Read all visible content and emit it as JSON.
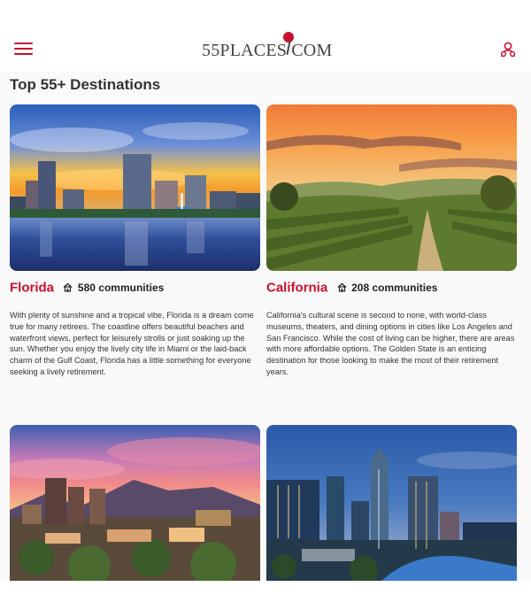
{
  "header": {
    "logo_text": "55PLACES COM"
  },
  "main": {
    "section_title": "Top 55+ Destinations"
  },
  "destinations": [
    {
      "name": "Florida",
      "count": "580 communities",
      "description": "With plenty of sunshine and a tropical vibe, Florida is a dream come true for many retirees. The coastline offers beautiful beaches and waterfront views, perfect for leisurely strolls or just soaking up the sun. Whether you enjoy the lively city life in Miami or the laid-back charm of the Gulf Coast, Florida has a little something for everyone seeking a lively retirement."
    },
    {
      "name": "California",
      "count": "208 communities",
      "description": "California's cultural scene is second to none, with world-class museums, theaters, and dining options in cities like Los Angeles and San Francisco. While the cost of living can be higher, there are areas with more affordable options. The Golden State is an enticing destination for those looking to make the most of their retirement years."
    },
    {
      "name": "",
      "count": "",
      "description": ""
    },
    {
      "name": "",
      "count": "",
      "description": ""
    }
  ],
  "colors": {
    "brand": "#c8102e",
    "heading": "#333333"
  },
  "icons": {
    "menu": "hamburger-menu-icon",
    "user": "user-icon",
    "community": "home-icon"
  }
}
